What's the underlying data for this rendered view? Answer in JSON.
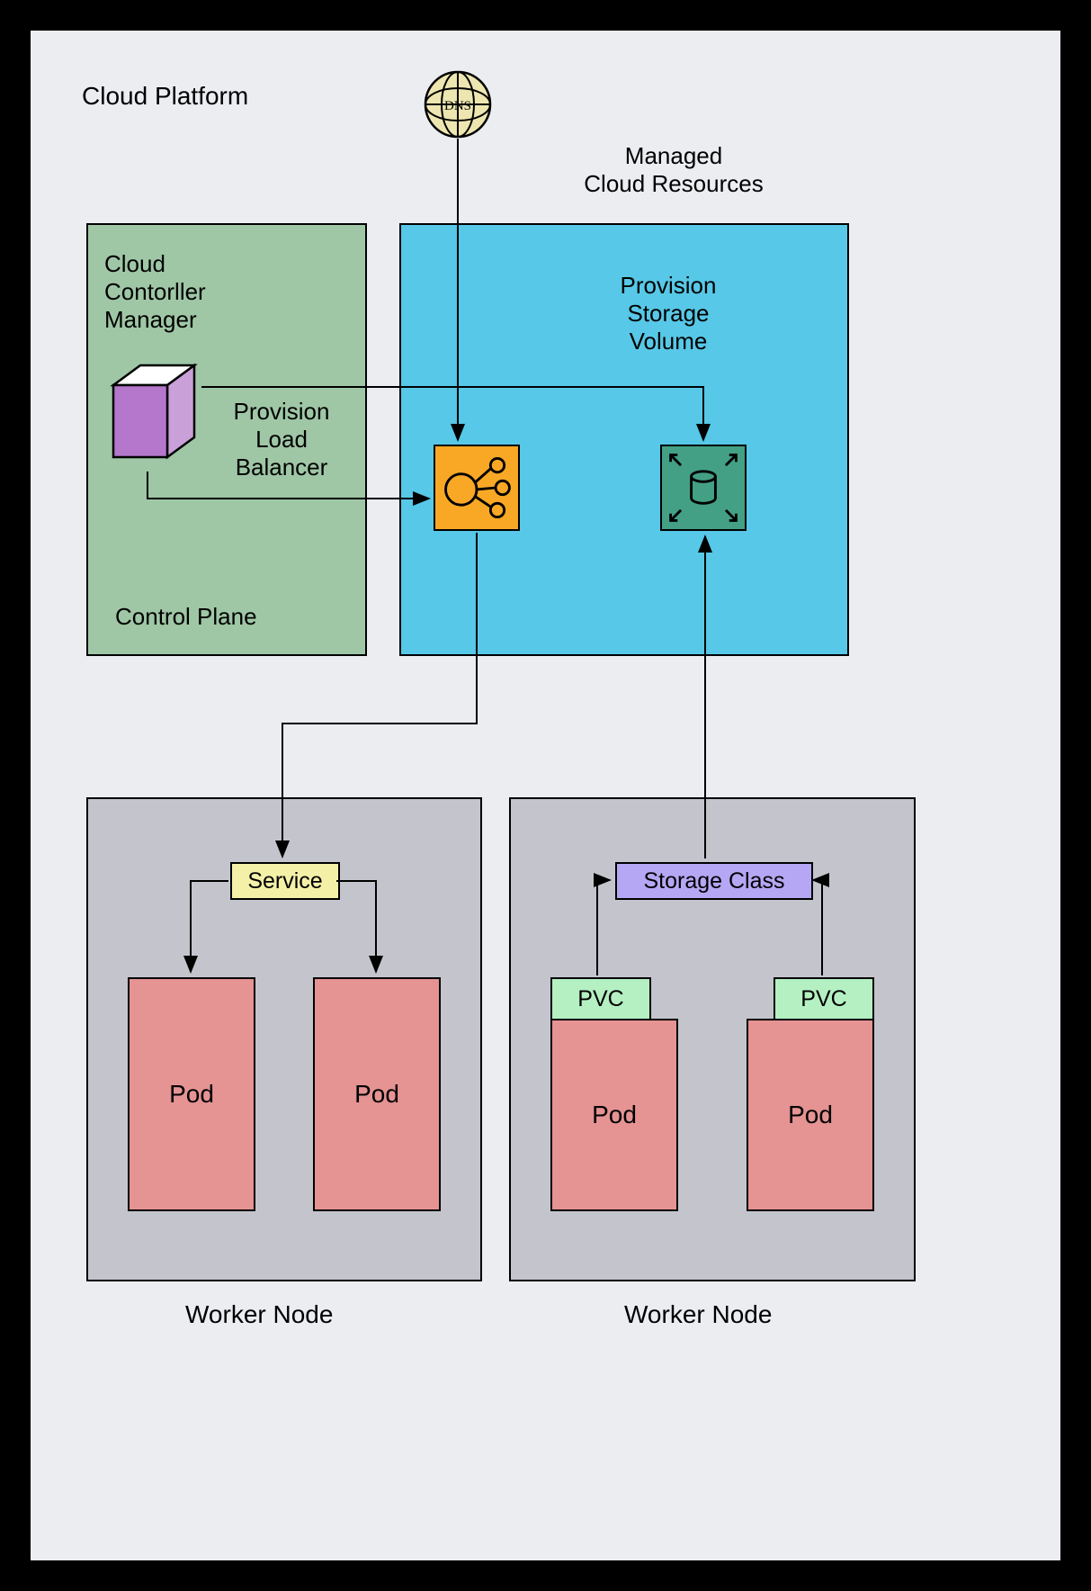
{
  "title": "Cloud Platform",
  "dns": {
    "label": "DNS"
  },
  "managedCloud": {
    "label": "Managed\nCloud Resources"
  },
  "ccm": {
    "label": "Cloud\nContorller\nManager"
  },
  "provisionLB": "Provision\nLoad\nBalancer",
  "provisionStorage": "Provision\nStorage\nVolume",
  "controlPlane": "Control Plane",
  "workerNode1": {
    "label": "Worker Node",
    "service": "Service",
    "pod1": "Pod",
    "pod2": "Pod"
  },
  "workerNode2": {
    "label": "Worker Node",
    "storageClass": "Storage Class",
    "pvc1": "PVC",
    "pvc2": "PVC",
    "pod1": "Pod",
    "pod2": "Pod"
  },
  "icons": {
    "lb": "load-balancer",
    "storage": "storage-volume"
  }
}
